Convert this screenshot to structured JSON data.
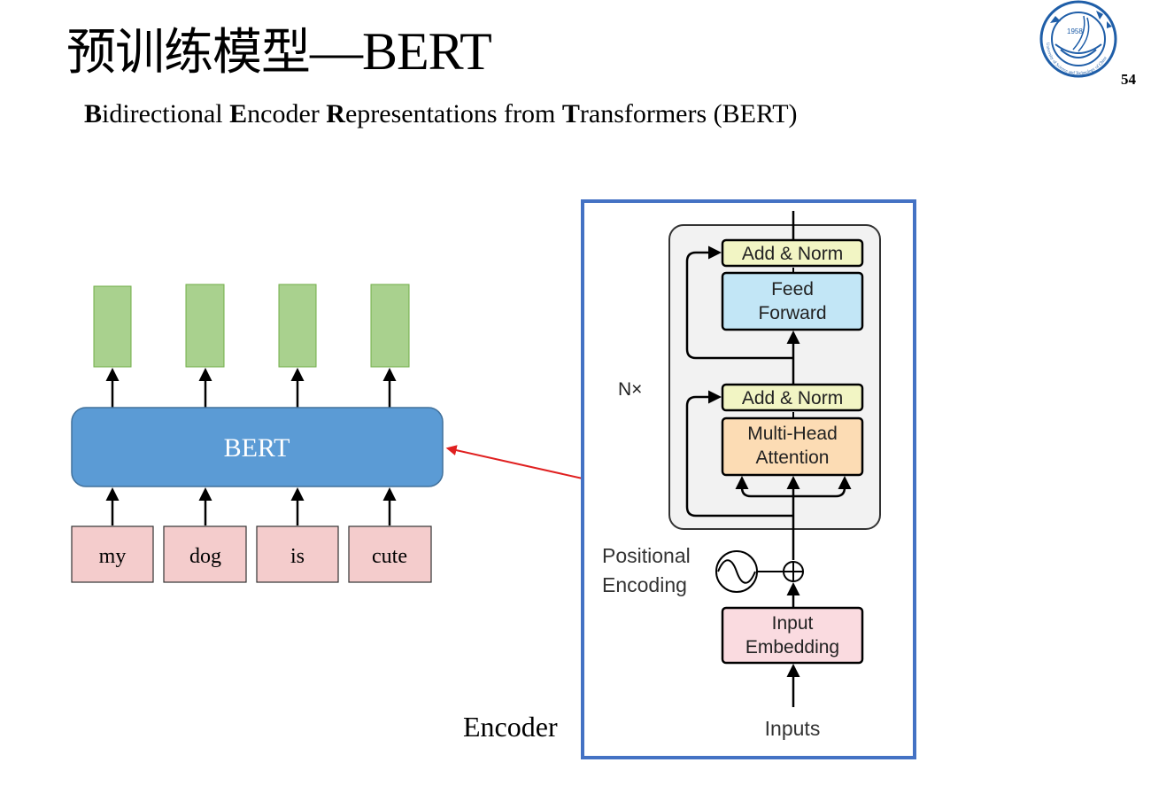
{
  "title": {
    "chinese": "预训练模型",
    "latin": "—BERT"
  },
  "subtitle": [
    {
      "bold": "B",
      "rest": "idirectional "
    },
    {
      "bold": "E",
      "rest": "ncoder "
    },
    {
      "bold": "R",
      "rest": "epresentations from "
    },
    {
      "bold": "T",
      "rest": "ransformers (BERT)"
    }
  ],
  "page_number": "54",
  "logo": {
    "year": "1958",
    "ring_text": "University of Science and Technology of China"
  },
  "bert_block": {
    "label": "BERT",
    "inputs": [
      "my",
      "dog",
      "is",
      "cute"
    ]
  },
  "encoder": {
    "caption": "Encoder",
    "repeat_label": "N×",
    "add_norm_top": "Add & Norm",
    "feed_forward_line1": "Feed",
    "feed_forward_line2": "Forward",
    "add_norm_bottom": "Add & Norm",
    "mha_line1": "Multi-Head",
    "mha_line2": "Attention",
    "positional_line1": "Positional",
    "positional_line2": "Encoding",
    "embedding_line1": "Input",
    "embedding_line2": "Embedding",
    "inputs_label": "Inputs"
  },
  "colors": {
    "bert_block": "#5b9bd5",
    "output_token": "#a9d18e",
    "input_token": "#f4cccc",
    "encoder_frame": "#4472c4",
    "add_norm": "#f2f5c4",
    "feed_forward": "#c2e6f6",
    "attention": "#fcdcb4",
    "embedding": "#fadbe0",
    "connector_arrow": "#e02020"
  }
}
